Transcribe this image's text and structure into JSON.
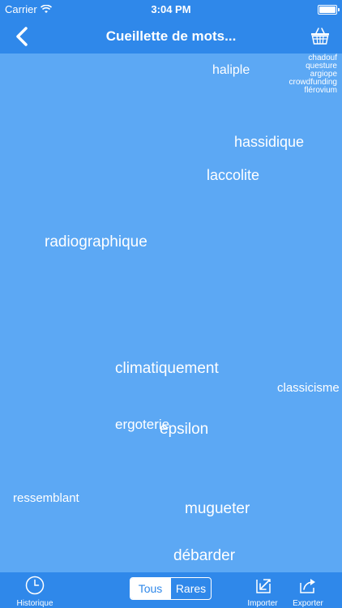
{
  "status_bar": {
    "carrier": "Carrier",
    "time": "3:04 PM"
  },
  "nav": {
    "title": "Cueillette de mots..."
  },
  "corner_words": [
    "chadouf",
    "questure",
    "argiope",
    "crowdfunding",
    "flérovium"
  ],
  "words": [
    "haliple",
    "hassidique",
    "laccolite",
    "radiographique",
    "climatiquement",
    "classicisme",
    "ergoterie",
    "epsilon",
    "ressemblant",
    "mugueter",
    "débarder"
  ],
  "tabbar": {
    "history_label": "Historique",
    "segment": {
      "all": "Tous",
      "rare": "Rares",
      "selected": "Tous"
    },
    "import_label": "Importer",
    "export_label": "Exporter"
  }
}
